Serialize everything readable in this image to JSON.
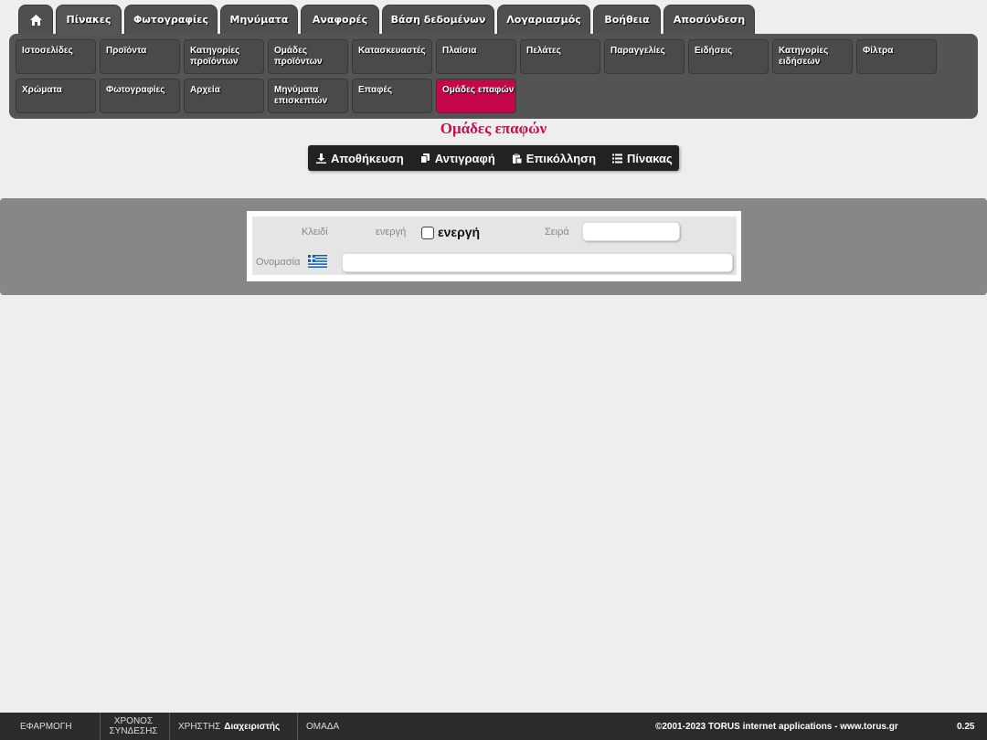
{
  "top_tabs": [
    {
      "icon": "home-icon"
    },
    {
      "label": "Πίνακες"
    },
    {
      "label": "Φωτογραφίες"
    },
    {
      "label": "Μηνύματα"
    },
    {
      "label": "Αναφορές"
    },
    {
      "label": "Βάση δεδομένων"
    },
    {
      "label": "Λογαριασμός"
    },
    {
      "label": "Βοήθεια"
    },
    {
      "label": "Αποσύνδεση"
    }
  ],
  "submenu": [
    {
      "label": "Ιστοσελίδες"
    },
    {
      "label": "Προϊόντα"
    },
    {
      "label": "Κατηγορίες προϊόντων"
    },
    {
      "label": "Ομάδες προϊόντων"
    },
    {
      "label": "Κατασκευαστές"
    },
    {
      "label": "Πλαίσια"
    },
    {
      "label": "Πελάτες"
    },
    {
      "label": "Παραγγελίες"
    },
    {
      "label": "Ειδήσεις"
    },
    {
      "label": "Κατηγορίες ειδήσεων"
    },
    {
      "label": "Φίλτρα"
    },
    {
      "label": "Χρώματα"
    },
    {
      "label": "Φωτογραφίες"
    },
    {
      "label": "Αρχεία"
    },
    {
      "label": "Μηνύματα επισκεπτών"
    },
    {
      "label": "Επαφές"
    },
    {
      "label": "Ομάδες επαφών",
      "active": true
    }
  ],
  "page_title": "Ομάδες επαφών",
  "toolbar": {
    "save": "Αποθήκευση",
    "copy": "Αντιγραφή",
    "paste": "Επικόλληση",
    "table": "Πίνακας"
  },
  "form": {
    "key_label": "Κλειδί",
    "active_label": "ενεργή",
    "active_checkbox_label": "ενεργή",
    "active_checked": false,
    "order_label": "Σειρά",
    "order_value": "",
    "name_label": "Ονομασία",
    "name_value": "",
    "name_language_icon": "greek-flag-icon"
  },
  "footer": {
    "app": "ΕΦΑΡΜΟΓΗ",
    "session_time_line1": "ΧΡΟΝΟΣ",
    "session_time_line2": "ΣΥΝΔΕΣΗΣ",
    "user_label": "ΧΡΗΣΤΗΣ",
    "user_value": "Διαχειριστής",
    "group": "ΟΜΑΔΑ",
    "copyright": "©2001-2023 TORUS internet applications - www.torus.gr",
    "version": "0.25"
  },
  "colors": {
    "accent": "#c11150",
    "active_submenu": "#c4074a",
    "menu_bg": "#545454",
    "toolbar_bg": "#222222",
    "footer_bg": "#2b2b2b"
  }
}
